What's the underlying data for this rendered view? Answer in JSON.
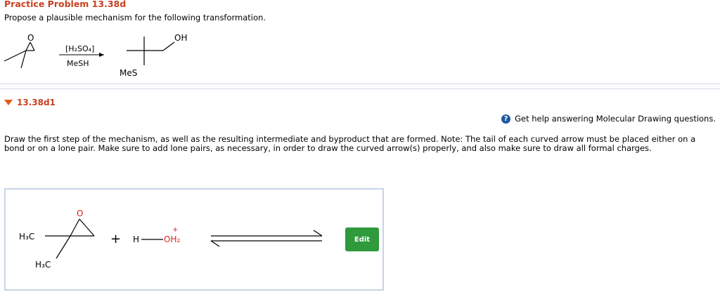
{
  "problem": {
    "title": "Practice Problem 13.38d",
    "prompt": "Propose a plausible mechanism for the following transformation."
  },
  "reaction": {
    "reactant_oxygen": "O",
    "reagent_top": "[H₂SO₄]",
    "reagent_bottom": "MeSH",
    "product_oh": "OH",
    "product_mes": "MeS"
  },
  "subpart": {
    "label": "13.38d1"
  },
  "help": {
    "icon": "question-circle-icon",
    "text": "Get help answering Molecular Drawing questions."
  },
  "instructions": "Draw the first step of the mechanism, as well as the resulting intermediate and byproduct that are formed. Note: The tail of each curved arrow must be placed either on a bond or on a lone pair. Make sure to add lone pairs, as necessary, in order to draw the curved arrow(s) properly, and also make sure to draw all formal charges.",
  "drawing": {
    "methyl_top": "H₃C",
    "methyl_bottom": "H₃C",
    "epoxide_oxygen": "O",
    "plus_sign": "+",
    "hydronium_h": "H",
    "hydronium_oh2": "OH₂",
    "charge": "+"
  },
  "edit_button": {
    "label": "Edit"
  },
  "colors": {
    "title": "#c8411f",
    "oxygen_red": "#e0201b",
    "edit_green": "#2f9a3b",
    "panel_border": "#c7d4e6"
  }
}
